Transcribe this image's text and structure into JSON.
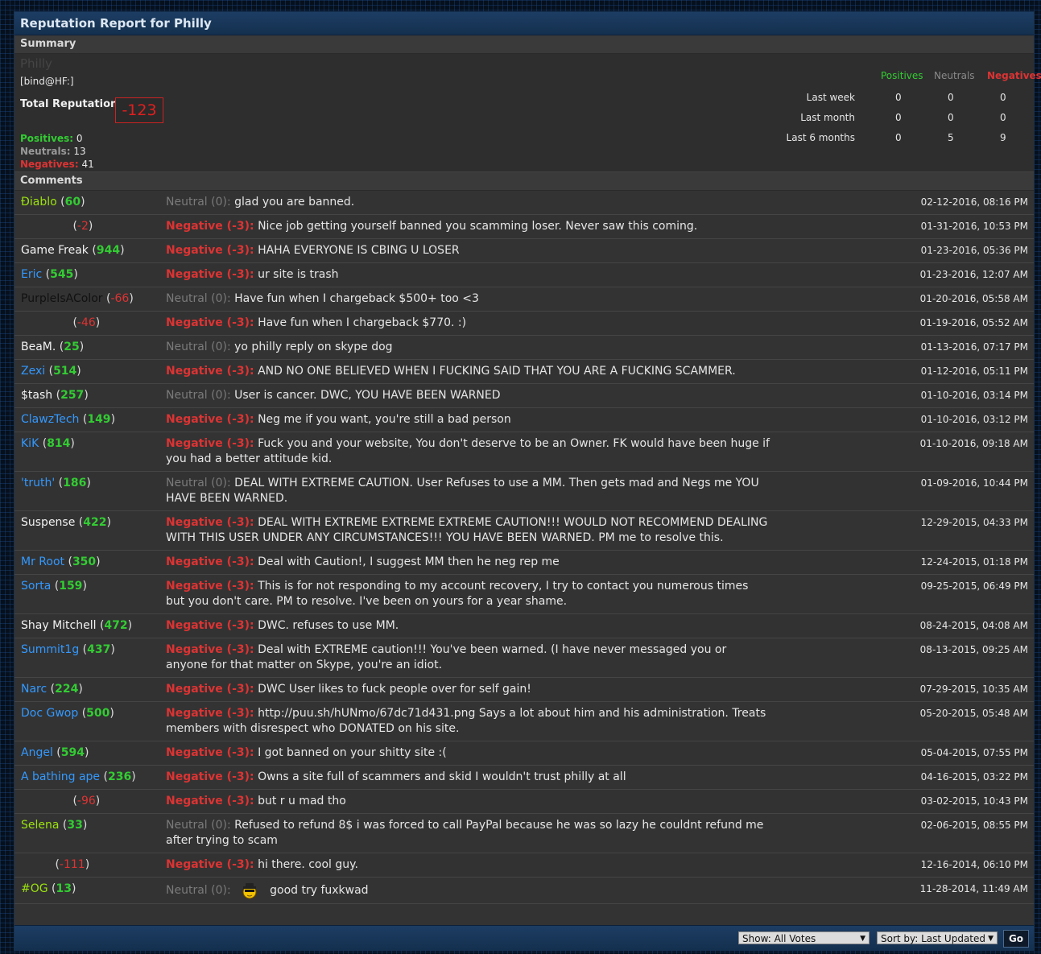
{
  "title": "Reputation Report for Philly",
  "summary": {
    "header": "Summary",
    "faded_name": "Philly",
    "usertitle": "[bind@HF:]",
    "total_label": "Total Reputation:",
    "total_value": "-123",
    "positives_label": "Positives:",
    "positives_value": "0",
    "neutrals_label": "Neutrals:",
    "neutrals_value": "13",
    "negatives_label": "Negatives:",
    "negatives_value": "41"
  },
  "stats": {
    "headers": [
      "Positives",
      "Neutrals",
      "Negatives"
    ],
    "rows": [
      {
        "label": "Last week",
        "values": [
          "0",
          "0",
          "0"
        ]
      },
      {
        "label": "Last month",
        "values": [
          "0",
          "0",
          "0"
        ]
      },
      {
        "label": "Last 6 months",
        "values": [
          "0",
          "5",
          "9"
        ]
      }
    ]
  },
  "comments_header": "Comments",
  "colors": {
    "positive": "#33cc33",
    "neutral": "#999999",
    "negative": "#dd3333",
    "accent_blue": "#1f6fb5"
  },
  "comments": [
    {
      "user": "Ðiablo",
      "user_color": "#9be20e",
      "rep": "60",
      "rep_type": "pos",
      "vote": "Neutral (0):",
      "vote_type": "neu",
      "text": "glad you are banned.",
      "date": "02-12-2016, 08:16 PM"
    },
    {
      "user": "",
      "user_color": "#4a4a4a",
      "rep": "-2",
      "rep_type": "neg",
      "vote": "Negative (-3):",
      "vote_type": "neg",
      "text": "Nice job getting yourself banned you scamming loser. Never saw this coming.",
      "date": "01-31-2016, 10:53 PM"
    },
    {
      "user": "Game Freak",
      "user_color": "#f2f2f2",
      "rep": "944",
      "rep_type": "pos",
      "vote": "Negative (-3):",
      "vote_type": "neg",
      "text": "HAHA EVERYONE IS CBING U LOSER",
      "date": "01-23-2016, 05:36 PM"
    },
    {
      "user": "Eric",
      "user_color": "#3399ff",
      "rep": "545",
      "rep_type": "pos",
      "vote": "Negative (-3):",
      "vote_type": "neg",
      "text": "ur site is trash",
      "date": "01-23-2016, 12:07 AM"
    },
    {
      "user": "PurpleIsAColor",
      "user_color": "#111111",
      "rep": "-66",
      "rep_type": "neg",
      "vote": "Neutral (0):",
      "vote_type": "neu",
      "text": "Have fun when I chargeback $500+ too <3",
      "date": "01-20-2016, 05:58 AM"
    },
    {
      "user": "",
      "user_color": "#4a4a4a",
      "rep": "-46",
      "rep_type": "neg",
      "vote": "Negative (-3):",
      "vote_type": "neg",
      "text": "Have fun when I chargeback $770. :)",
      "date": "01-19-2016, 05:52 AM"
    },
    {
      "user": "BeaM.",
      "user_color": "#f2f2f2",
      "rep": "25",
      "rep_type": "pos",
      "vote": "Neutral (0):",
      "vote_type": "neu",
      "text": "yo philly reply on skype dog",
      "date": "01-13-2016, 07:17 PM"
    },
    {
      "user": "Zexi",
      "user_color": "#3399ff",
      "rep": "514",
      "rep_type": "pos",
      "vote": "Negative (-3):",
      "vote_type": "neg",
      "text": "AND NO ONE BELIEVED WHEN I FUCKING SAID THAT YOU ARE A FUCKING SCAMMER.",
      "date": "01-12-2016, 05:11 PM"
    },
    {
      "user": "$tash",
      "user_color": "#f2f2f2",
      "rep": "257",
      "rep_type": "pos",
      "vote": "Neutral (0):",
      "vote_type": "neu",
      "text": "User is cancer. DWC, YOU HAVE BEEN WARNED",
      "date": "01-10-2016, 03:14 PM"
    },
    {
      "user": "ClawzTech",
      "user_color": "#3399ff",
      "rep": "149",
      "rep_type": "pos",
      "vote": "Negative (-3):",
      "vote_type": "neg",
      "text": "Neg me if you want, you're still a bad person",
      "date": "01-10-2016, 03:12 PM"
    },
    {
      "user": "KiK",
      "user_color": "#3399ff",
      "rep": "814",
      "rep_type": "pos",
      "vote": "Negative (-3):",
      "vote_type": "neg",
      "text": "Fuck you and your website, You don't deserve to be an Owner. FK would have been huge if you had a better attitude kid.",
      "date": "01-10-2016, 09:18 AM"
    },
    {
      "user": "'truth'",
      "user_color": "#3399ff",
      "rep": "186",
      "rep_type": "pos",
      "vote": "Neutral (0):",
      "vote_type": "neu",
      "text": "DEAL WITH EXTREME CAUTION. User Refuses to use a MM. Then gets mad and Negs me YOU HAVE BEEN WARNED.",
      "date": "01-09-2016, 10:44 PM"
    },
    {
      "user": "Suspense",
      "user_color": "#f2f2f2",
      "rep": "422",
      "rep_type": "pos",
      "vote": "Negative (-3):",
      "vote_type": "neg",
      "text": "DEAL WITH EXTREME EXTREME EXTREME CAUTION!!! WOULD NOT RECOMMEND DEALING WITH THIS USER UNDER ANY CIRCUMSTANCES!!! YOU HAVE BEEN WARNED. PM me to resolve this.",
      "date": "12-29-2015, 04:33 PM"
    },
    {
      "user": "Mr Root",
      "user_color": "#3399ff",
      "rep": "350",
      "rep_type": "pos",
      "vote": "Negative (-3):",
      "vote_type": "neg",
      "text": "Deal with Caution!, I suggest MM then he neg rep me",
      "date": "12-24-2015, 01:18 PM"
    },
    {
      "user": "Sorta",
      "user_color": "#3399ff",
      "rep": "159",
      "rep_type": "pos",
      "vote": "Negative (-3):",
      "vote_type": "neg",
      "text": "This is for not responding to my account recovery, I try to contact you numerous times but you don't care. PM to resolve. I've been on yours for a year shame.",
      "date": "09-25-2015, 06:49 PM"
    },
    {
      "user": "Shay Mitchell",
      "user_color": "#f2f2f2",
      "rep": "472",
      "rep_type": "pos",
      "vote": "Negative (-3):",
      "vote_type": "neg",
      "text": "DWC. refuses to use MM.",
      "date": "08-24-2015, 04:08 AM"
    },
    {
      "user": "Summit1g",
      "user_color": "#3399ff",
      "rep": "437",
      "rep_type": "pos",
      "vote": "Negative (-3):",
      "vote_type": "neg",
      "text": "Deal with EXTREME caution!!! You've been warned. (I have never messaged you or anyone for that matter on Skype, you're an idiot.",
      "date": "08-13-2015, 09:25 AM"
    },
    {
      "user": "Narc",
      "user_color": "#3399ff",
      "rep": "224",
      "rep_type": "pos",
      "vote": "Negative (-3):",
      "vote_type": "neg",
      "text": "DWC User likes to fuck people over for self gain!",
      "date": "07-29-2015, 10:35 AM"
    },
    {
      "user": "Doc Gwop",
      "user_color": "#3399ff",
      "rep": "500",
      "rep_type": "pos",
      "vote": "Negative (-3):",
      "vote_type": "neg",
      "text": "http://puu.sh/hUNmo/67dc71d431.png Says a lot about him and his administration. Treats members with disrespect who DONATED on his site.",
      "date": "05-20-2015, 05:48 AM"
    },
    {
      "user": "Angel",
      "user_color": "#3399ff",
      "rep": "594",
      "rep_type": "pos",
      "vote": "Negative (-3):",
      "vote_type": "neg",
      "text": "I got banned on your shitty site :(",
      "date": "05-04-2015, 07:55 PM"
    },
    {
      "user": "A bathing ape",
      "user_color": "#3399ff",
      "rep": "236",
      "rep_type": "pos",
      "vote": "Negative (-3):",
      "vote_type": "neg",
      "text": "Owns a site full of scammers and skid I wouldn't trust philly at all",
      "date": "04-16-2015, 03:22 PM"
    },
    {
      "user": "",
      "user_color": "#4a4a4a",
      "rep": "-96",
      "rep_type": "neg",
      "vote": "Negative (-3):",
      "vote_type": "neg",
      "text": "but r u mad tho",
      "date": "03-02-2015, 10:43 PM"
    },
    {
      "user": "Selena",
      "user_color": "#9be20e",
      "rep": "33",
      "rep_type": "pos",
      "vote": "Neutral (0):",
      "vote_type": "neu",
      "text": "Refused to refund 8$ i was forced to call PayPal because he was so lazy he couldnt refund me after trying to scam",
      "date": "02-06-2015, 08:55 PM"
    },
    {
      "user": "",
      "user_color": "#4a4a4a",
      "rep": "-111",
      "rep_type": "neg",
      "vote": "Negative (-3):",
      "vote_type": "neg",
      "text": "hi there. cool guy.",
      "date": "12-16-2014, 06:10 PM"
    },
    {
      "user": "#OG",
      "user_color": "#9be20e",
      "rep": "13",
      "rep_type": "pos",
      "vote": "Neutral (0):",
      "vote_type": "neu",
      "text": "good try fuxkwad",
      "date": "11-28-2014, 11:49 AM",
      "emoji": "spy-smiley"
    }
  ],
  "footer": {
    "show_select": "Show: All Votes",
    "sort_select": "Sort by: Last Updated",
    "go_label": "Go"
  }
}
